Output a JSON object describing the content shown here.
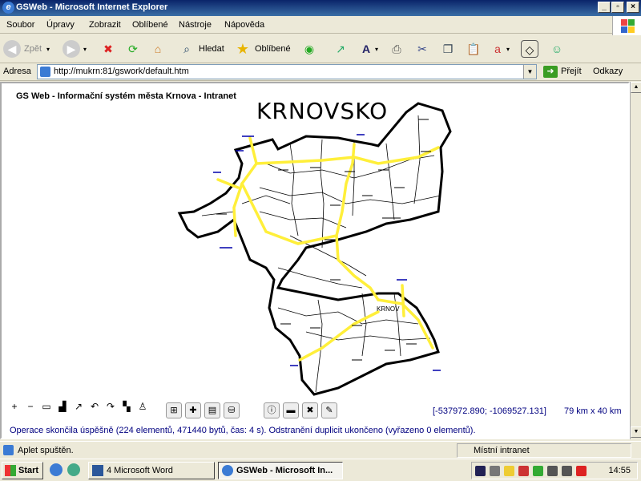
{
  "window": {
    "title": "GSWeb - Microsoft Internet Explorer"
  },
  "menu": [
    "Soubor",
    "Úpravy",
    "Zobrazit",
    "Oblíbené",
    "Nástroje",
    "Nápověda"
  ],
  "toolbar": {
    "back": "Zpět",
    "search": "Hledat",
    "favorites": "Oblíbené"
  },
  "address": {
    "label": "Adresa",
    "url": "http://mukrn:81/gswork/default.htm",
    "go": "Přejít",
    "links": "Odkazy"
  },
  "page": {
    "app_title": "GS Web - Informační systém města Krnova - Intranet",
    "map_title": "KRNOVSKO",
    "city_label": "KRNOV",
    "coords": "[-537972.890; -1069527.131]",
    "scale": "79 km x 40 km",
    "status_message": "Operace skončila úspěšně (224 elementů, 471440 bytů, čas: 4 s). Odstranění duplicit ukončeno (vyřazeno 0 elementů)."
  },
  "statusbar": {
    "text": "Aplet spuštěn.",
    "zone": "Místní intranet"
  },
  "taskbar": {
    "start": "Start",
    "tasks": [
      "4 Microsoft Word",
      "GSWeb - Microsoft In..."
    ],
    "clock": "14:55"
  },
  "colors": {
    "road": "#ffef3a",
    "link": "#000080",
    "titlebar": "#0a246a"
  }
}
